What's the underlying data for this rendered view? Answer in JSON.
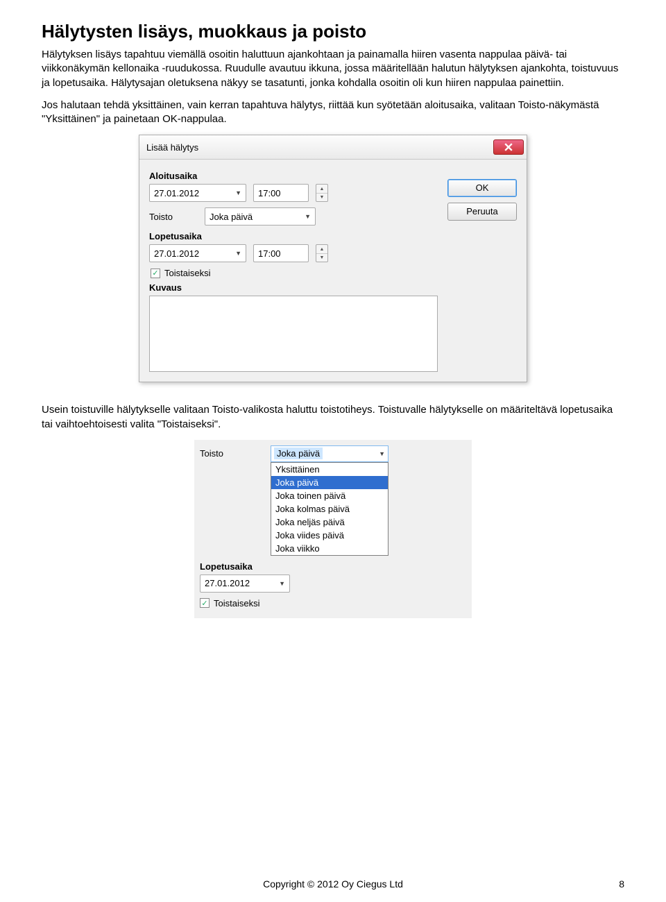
{
  "doc": {
    "heading": "Hälytysten lisäys, muokkaus ja poisto",
    "para1": "Hälytyksen lisäys tapahtuu viemällä osoitin haluttuun ajankohtaan ja painamalla hiiren vasenta nappulaa päivä- tai viikkonäkymän kellonaika -ruudukossa. Ruudulle avautuu ikkuna, jossa määritellään halutun hälytyksen ajankohta, toistuvuus ja lopetusaika. Hälytysajan oletuksena näkyy se tasatunti, jonka kohdalla osoitin oli kun hiiren nappulaa painettiin.",
    "para2": "Jos halutaan tehdä yksittäinen, vain kerran tapahtuva hälytys, riittää kun syötetään aloitusaika, valitaan Toisto-näkymästä \"Yksittäinen\" ja painetaan OK-nappulaa.",
    "para3": "Usein toistuville hälytykselle valitaan Toisto-valikosta haluttu toistotiheys. Toistuvalle hälytykselle on määriteltävä lopetusaika tai vaihtoehtoisesti valita \"Toistaiseksi\"."
  },
  "dialog": {
    "title": "Lisää hälytys",
    "start_label": "Aloitusaika",
    "start_date": "27.01.2012",
    "start_time": "17:00",
    "repeat_label": "Toisto",
    "repeat_value": "Joka päivä",
    "end_label": "Lopetusaika",
    "end_date": "27.01.2012",
    "end_time": "17:00",
    "until_further": "Toistaiseksi",
    "desc_label": "Kuvaus",
    "desc_value": "",
    "ok": "OK",
    "cancel": "Peruuta"
  },
  "snippet": {
    "repeat_label": "Toisto",
    "selected": "Joka päivä",
    "options": [
      "Yksittäinen",
      "Joka päivä",
      "Joka toinen päivä",
      "Joka kolmas päivä",
      "Joka neljäs päivä",
      "Joka viides päivä",
      "Joka viikko"
    ],
    "end_label": "Lopetusaika",
    "end_date": "27.01.2012",
    "until_further": "Toistaiseksi"
  },
  "footer": {
    "copyright": "Copyright © 2012 Oy Ciegus Ltd",
    "page": "8"
  }
}
